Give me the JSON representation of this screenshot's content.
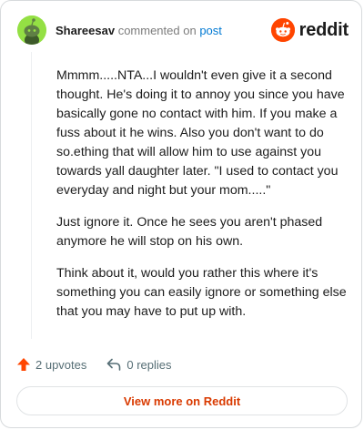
{
  "header": {
    "username": "Shareesav",
    "action": "commented on",
    "post_link": "post",
    "brand": "reddit"
  },
  "comment": {
    "paragraphs": [
      "Mmmm.....NTA...I wouldn't even give it a second thought. He's doing it to annoy you since you have basically gone no contact with him. If you make a fuss about it he wins. Also you don't want to do so.ething that will allow him to use against you towards yall daughter later. \"I used to contact you everyday and night but your mom.....\"",
      "Just ignore it. Once he sees you aren't phased anymore he will stop on his own.",
      "Think about it, would you rather this where it's something you can easily ignore or something else that you may have to put up with."
    ]
  },
  "footer": {
    "upvotes": "2 upvotes",
    "replies": "0 replies",
    "view_more": "View more on Reddit"
  },
  "colors": {
    "accent": "#ff4500",
    "link": "#0079d3",
    "avatar_bg": "#94e044"
  }
}
